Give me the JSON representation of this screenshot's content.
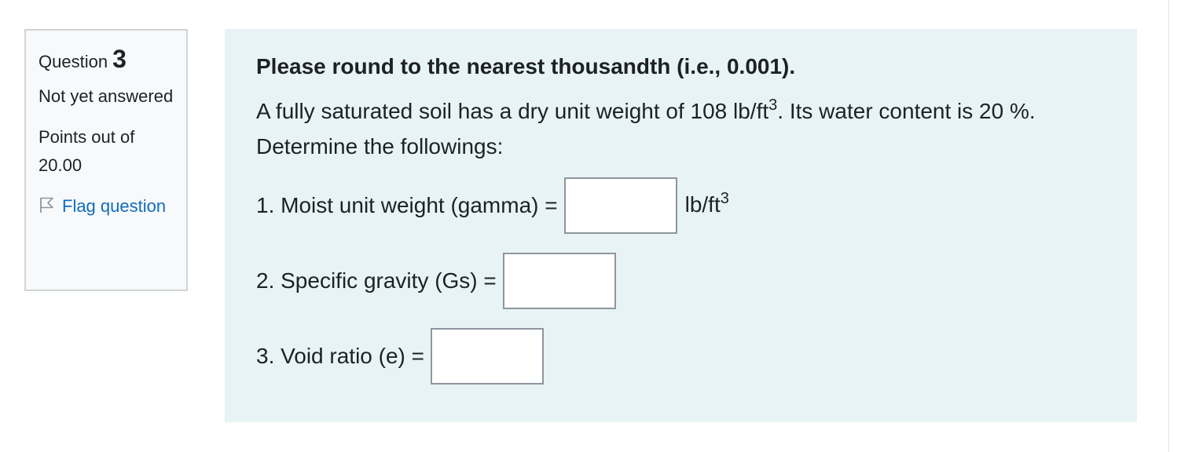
{
  "question_info": {
    "label": "Question",
    "number": "3",
    "state": "Not yet answered",
    "grade": "Points out of 20.00",
    "flag_label": "Flag question"
  },
  "content": {
    "heading": "Please round to the nearest thousandth (i.e., 0.001).",
    "problem": {
      "text_before": "A fully saturated soil has a dry unit weight of 108 lb/ft",
      "superscript": "3",
      "text_after": ". Its water content is 20 %. Determine the followings:"
    },
    "items": [
      {
        "label": "1. Moist unit weight (gamma) =",
        "value": "",
        "unit": "lb/ft",
        "unit_sup": "3"
      },
      {
        "label": "2. Specific gravity (Gs) =",
        "value": ""
      },
      {
        "label": "3. Void ratio (e) =",
        "value": ""
      }
    ]
  },
  "icons": {
    "flag": "flag-outline-icon"
  },
  "colors": {
    "content_background": "#e7f3f5",
    "info_background": "#f8f9fa",
    "link": "#0f6cbf"
  }
}
